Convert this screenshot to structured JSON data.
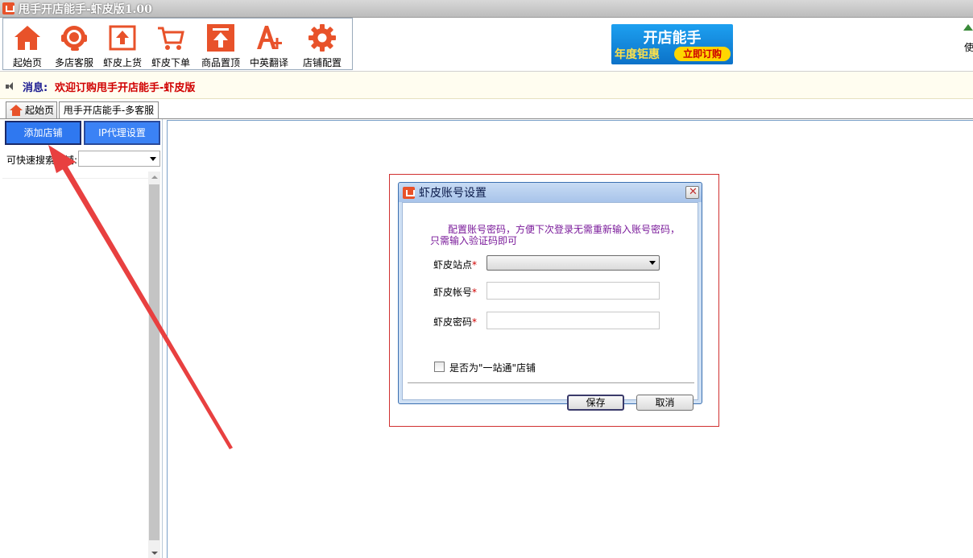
{
  "window": {
    "title": "甩手开店能手-虾皮版1.00"
  },
  "toolbar": {
    "items": [
      {
        "label": "起始页",
        "icon": "home-icon"
      },
      {
        "label": "多店客服",
        "icon": "customer-service-icon"
      },
      {
        "label": "虾皮上货",
        "icon": "upload-box-icon"
      },
      {
        "label": "虾皮下单",
        "icon": "shopping-cart-icon"
      },
      {
        "label": "商品置顶",
        "icon": "pin-top-icon"
      },
      {
        "label": "中英翻译",
        "icon": "translate-icon"
      },
      {
        "label": "店铺配置",
        "icon": "gear-icon"
      }
    ]
  },
  "promo": {
    "line1": "开店能手",
    "line2": "年度钜惠",
    "button": "立即订购"
  },
  "right_edge_text": "使",
  "message": {
    "label": "消息:",
    "text": "欢迎订购甩手开店能手-虾皮版"
  },
  "tabs": [
    {
      "label": "起始页"
    },
    {
      "label": "甩手开店能手-多客服"
    }
  ],
  "left": {
    "add_shop": "添加店铺",
    "ip_proxy": "IP代理设置",
    "quick_search_label": "可快速搜索店铺:"
  },
  "dialog": {
    "title": "虾皮账号设置",
    "note_line1": "配置账号密码，方便下次登录无需重新输入账号密码，",
    "note_line2": "只需输入验证码即可",
    "site_label": "虾皮站点",
    "account_label": "虾皮帐号",
    "password_label": "虾皮密码",
    "required_mark": "*",
    "checkbox_label": "是否为\"一站通\"店铺",
    "save": "保存",
    "cancel": "取消"
  },
  "colors": {
    "accent_orange": "#e8522a",
    "button_blue": "#2f78f0",
    "message_red": "#d00000",
    "annotation_red": "#e84040"
  }
}
